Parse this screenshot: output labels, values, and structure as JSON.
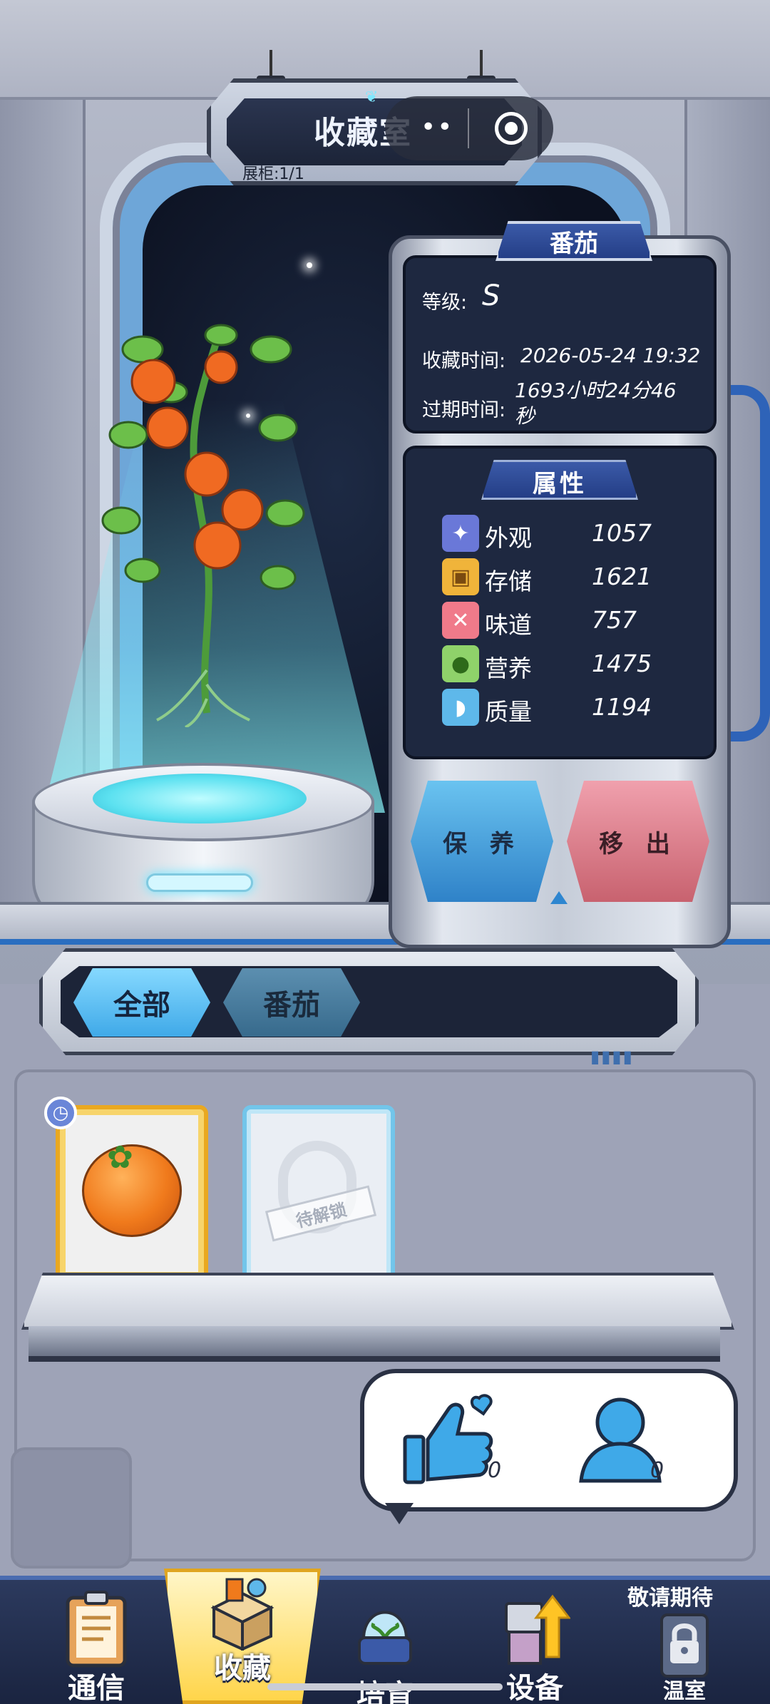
{
  "header": {
    "title": "收藏室",
    "subtitle": "展柜:1/1",
    "capsule_more": "••",
    "capsule_close": "target-icon"
  },
  "detail": {
    "name": "番茄",
    "level_label": "等级:",
    "level_value": "S",
    "collect_time_label": "收藏时间:",
    "collect_time_value": "2026-05-24 19:32",
    "expire_label": "过期时间:",
    "expire_value": "1693小时24分46秒",
    "attr_title": "属性",
    "attributes": [
      {
        "icon": "sparkle-icon",
        "label": "外观",
        "value": "1057",
        "color": "#6a78d8"
      },
      {
        "icon": "box-icon",
        "label": "存储",
        "value": "1621",
        "color": "#f0b43a"
      },
      {
        "icon": "utensils-icon",
        "label": "味道",
        "value": "757",
        "color": "#f07a8a"
      },
      {
        "icon": "apple-icon",
        "label": "营养",
        "value": "1475",
        "color": "#8fd26a"
      },
      {
        "icon": "muscle-icon",
        "label": "质量",
        "value": "1194",
        "color": "#5eb8ea"
      }
    ],
    "keep_button": "保 养",
    "remove_button": "移 出"
  },
  "filters": {
    "all": "全部",
    "tomato": "番茄"
  },
  "collection": {
    "locked_label": "待解锁"
  },
  "social": {
    "likes": "0",
    "friends": "0"
  },
  "nav": {
    "items": [
      {
        "label": "通信",
        "icon": "clipboard-icon"
      },
      {
        "label": "收藏",
        "icon": "collection-box-icon"
      },
      {
        "label": "培育",
        "icon": "terrarium-icon"
      },
      {
        "label": "设备",
        "icon": "device-upgrade-icon"
      },
      {
        "label": "温室",
        "icon": "lock-icon"
      }
    ],
    "coming_soon": "敬请期待"
  },
  "colors": {
    "accent_blue": "#3fa9e8",
    "remove_red": "#c8626f",
    "panel_dark": "#1e2840"
  }
}
